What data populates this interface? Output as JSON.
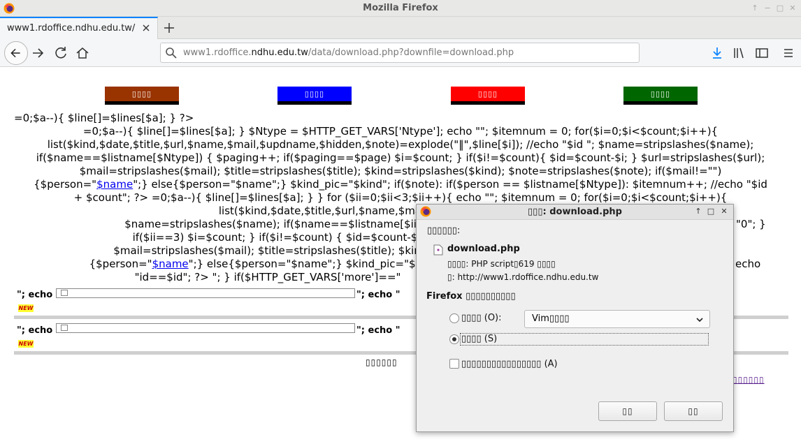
{
  "window": {
    "title": "Mozilla Firefox"
  },
  "tab": {
    "title": "www1.rdoffice.ndhu.edu.tw/"
  },
  "urlbar": {
    "prefix": "www1.rdoffice.",
    "domain": "ndhu.edu.tw",
    "path": "/data/download.php?downfile=download.php"
  },
  "page": {
    "buttons": [
      {
        "label": "▯▯▯▯",
        "color": "#993300"
      },
      {
        "label": "▯▯▯▯",
        "color": "#0000ff"
      },
      {
        "label": "▯▯▯▯",
        "color": "#ff0000"
      },
      {
        "label": "▯▯▯▯",
        "color": "#006600"
      }
    ],
    "code": [
      "=0;$a--){ $line[]=$lines[$a]; } ?>",
      "=0;$a--){ $line[]=$lines[$a]; } $Ntype = $HTTP_GET_VARS['Ntype']; echo \"\"; $itemnum = 0; for($i=0;$i<$count;$i++){",
      "list($kind,$date,$title,$url,$name,$mail,$updname,$hidden,$note)=explode(\"‖\",$line[$i]); //echo \"$id \"; $name=stripslashes($name);",
      "if($name==$listname[$Ntype]) { $paging++; if($paging==$page) $i=$count; } if($i!=$count){ $id=$count-$i; } $url=stripslashes($url);",
      "$mail=stripslashes($mail); $title=stripslashes($title); $kind=stripslashes($kind); $note=stripslashes($note); if($mail!=\"\")",
      "+ $count\"; ?> =0;$a--){ $line[]=$lines[$a]; } } for ($ii=0;$ii<3;$ii++){ echo \"\"; $itemnum = 0; for($i=0;$i<$count;$i++){",
      "list($kind,$date,$title,$url,$name,$mail,$updname,$hidde",
      "$name=stripslashes($name); if($name==$listname[$ii]) { $paging",
      "if($ii==3) $i=$count; } if($i!=$count) { $id=$count-$i; } if($t",
      "$mail=stripslashes($mail); $title=stripslashes($title); $kind=str",
      "\"id==$id\"; ?> \"; } if($HTTP_GET_VARS['more']==\""
    ],
    "code_line5_pre": "{$person=\"",
    "code_line5_link": "$name",
    "code_line5_post": "\";} else{$person=\"$name\";} $kind_pic=\"$kind\"; if($note): if($person == $listname[$Ntype]): $itemnum++; //echo \"$id",
    "code_line10_pre": "{$person=\"",
    "code_line10_link": "$name",
    "code_line10_post": "\";} else{$person=\"$name\";} $kind_pic=\"$kind\";",
    "code_line9_tail": "\"0\"; }",
    "code_line11_tail": "echo",
    "echo_left": "\"; echo \"",
    "echo_right": "\"; echo \"",
    "new_badge": "NEW",
    "footer_text": "▯▯▯▯▯▯",
    "footer_link": "▯▯▯▯▯▯"
  },
  "dialog": {
    "title": "▯▯▯: download.php",
    "opening_label": "▯▯▯▯▯▯:",
    "filename": "download.php",
    "type_label": "▯▯▯▯: PHP script▯619 ▯▯▯▯",
    "from_label": "▯: http://www1.rdoffice.ndhu.edu.tw",
    "question": "Firefox ▯▯▯▯▯▯▯▯▯▯",
    "open_with_label": "▯▯▯▯ (O):",
    "open_with_app": "Vim▯▯▯▯",
    "save_label": "▯▯▯▯ (S)",
    "remember_label": "▯▯▯▯▯▯▯▯▯▯▯▯▯▯▯▯ (A)",
    "ok_button": "▯▯",
    "cancel_button": "▯▯"
  }
}
